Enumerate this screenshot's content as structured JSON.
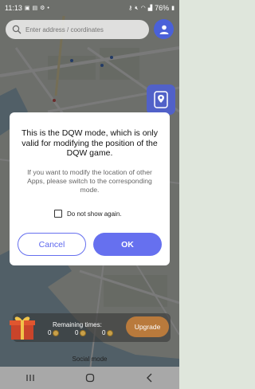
{
  "status_bar": {
    "time": "11:13",
    "battery": "76%"
  },
  "search": {
    "placeholder": "Enter address / coordinates"
  },
  "dialog": {
    "title": "This is the DQW mode, which is only valid for modifying the position of the DQW game.",
    "message": "If you want to modify the location of other Apps, please switch to the corresponding mode.",
    "checkbox_label": "Do not show again.",
    "cancel_label": "Cancel",
    "ok_label": "OK"
  },
  "bottom_panel": {
    "remaining_title": "Remaining times:",
    "counters": [
      "0",
      "0",
      "0"
    ],
    "upgrade_label": "Upgrade",
    "mode_label": "Social mode"
  },
  "colors": {
    "accent": "#6670ef",
    "profile": "#4a61d9",
    "upgrade": "#b97a3c"
  },
  "icons": [
    "search-icon",
    "profile-icon",
    "location-pin-icon",
    "gift-icon",
    "coin-icon",
    "recent-apps-icon",
    "home-icon",
    "back-icon"
  ]
}
